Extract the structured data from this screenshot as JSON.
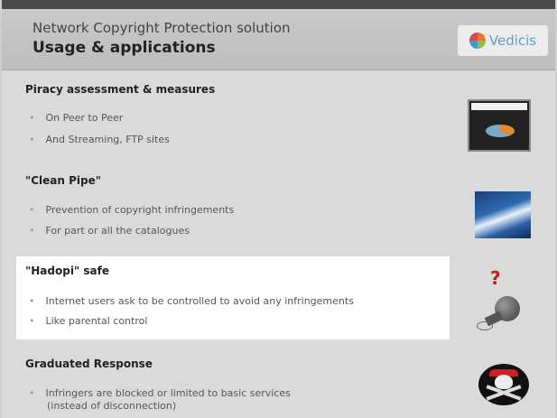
{
  "header": {
    "subtitle": "Network Copyright Protection solution",
    "title": "Usage & applications",
    "logo_text": "Vedicis"
  },
  "sections": [
    {
      "title": "Piracy assessment & measures",
      "bullets": [
        "On Peer to Peer",
        "And Streaming, FTP sites"
      ]
    },
    {
      "title": "\"Clean Pipe\"",
      "bullets": [
        "Prevention of copyright infringements",
        "For part or all the catalogues"
      ]
    },
    {
      "title": "\"Hadopi\" safe",
      "bullets": [
        "Internet users ask to be controlled to avoid any infringements",
        "Like parental control"
      ]
    },
    {
      "title": "Graduated Response",
      "bullets": [
        "Infringers are blocked or limited to basic  services",
        "(instead of disconnection)"
      ]
    }
  ],
  "question_mark": "?",
  "bullet_symbol": "•"
}
